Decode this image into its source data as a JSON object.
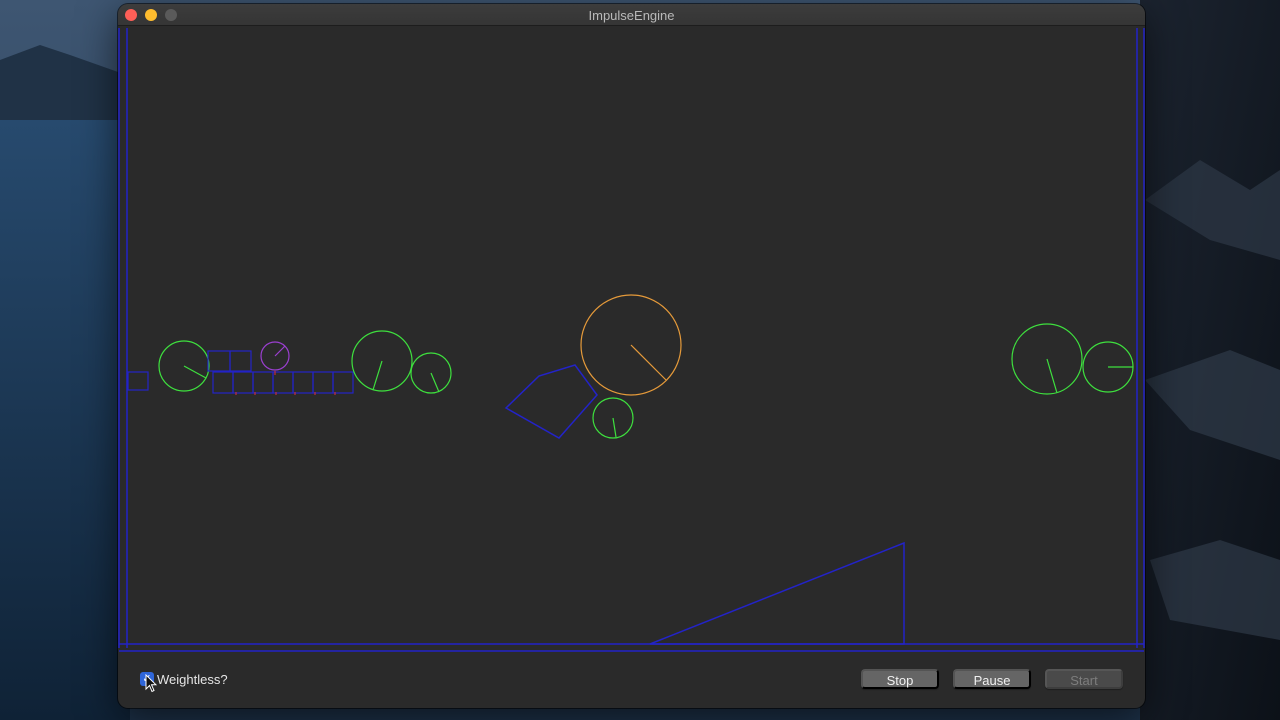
{
  "window": {
    "title": "ImpulseEngine"
  },
  "controls": {
    "weightless_label": "Weightless?",
    "weightless_checked": true,
    "stop_label": "Stop",
    "pause_label": "Pause",
    "start_label": "Start",
    "start_enabled": false
  },
  "icons": {
    "close": "close-icon",
    "minimize": "minimize-icon",
    "zoom": "zoom-icon",
    "check": "checkmark-icon",
    "cursor": "cursor-icon"
  },
  "colors": {
    "static_body": "#2323c8",
    "circle_green": "#3ee03e",
    "circle_orange": "#e59a3a",
    "circle_purple": "#9b3fd0",
    "contact_red": "#e03030",
    "canvas_bg": "#2a2a2a",
    "checkbox": "#2f66d9"
  }
}
